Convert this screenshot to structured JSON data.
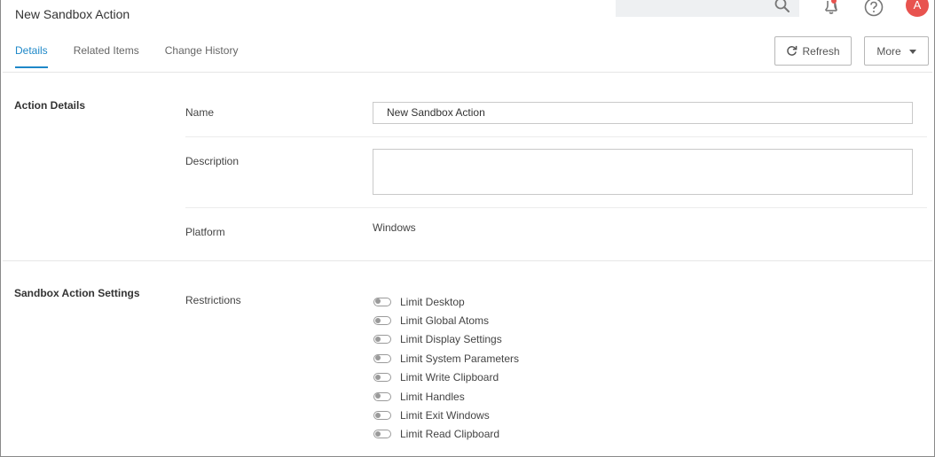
{
  "header": {
    "title": "New Sandbox Action",
    "avatar_initial": "A"
  },
  "tabs": [
    {
      "label": "Details",
      "active": true
    },
    {
      "label": "Related Items",
      "active": false
    },
    {
      "label": "Change History",
      "active": false
    }
  ],
  "toolbar": {
    "refresh_label": "Refresh",
    "more_label": "More"
  },
  "action_details": {
    "section_title": "Action Details",
    "name_label": "Name",
    "name_value": "New Sandbox Action",
    "description_label": "Description",
    "description_value": "",
    "platform_label": "Platform",
    "platform_value": "Windows"
  },
  "sandbox_settings": {
    "section_title": "Sandbox Action Settings",
    "restrictions_label": "Restrictions",
    "restrictions": [
      {
        "label": "Limit Desktop",
        "enabled": false
      },
      {
        "label": "Limit Global Atoms",
        "enabled": false
      },
      {
        "label": "Limit Display Settings",
        "enabled": false
      },
      {
        "label": "Limit System Parameters",
        "enabled": false
      },
      {
        "label": "Limit Write Clipboard",
        "enabled": false
      },
      {
        "label": "Limit Handles",
        "enabled": false
      },
      {
        "label": "Limit Exit Windows",
        "enabled": false
      },
      {
        "label": "Limit Read Clipboard",
        "enabled": false
      }
    ]
  },
  "colors": {
    "accent": "#1e88c8",
    "avatar": "#e8534f",
    "notification_dot": "#e8534f"
  }
}
